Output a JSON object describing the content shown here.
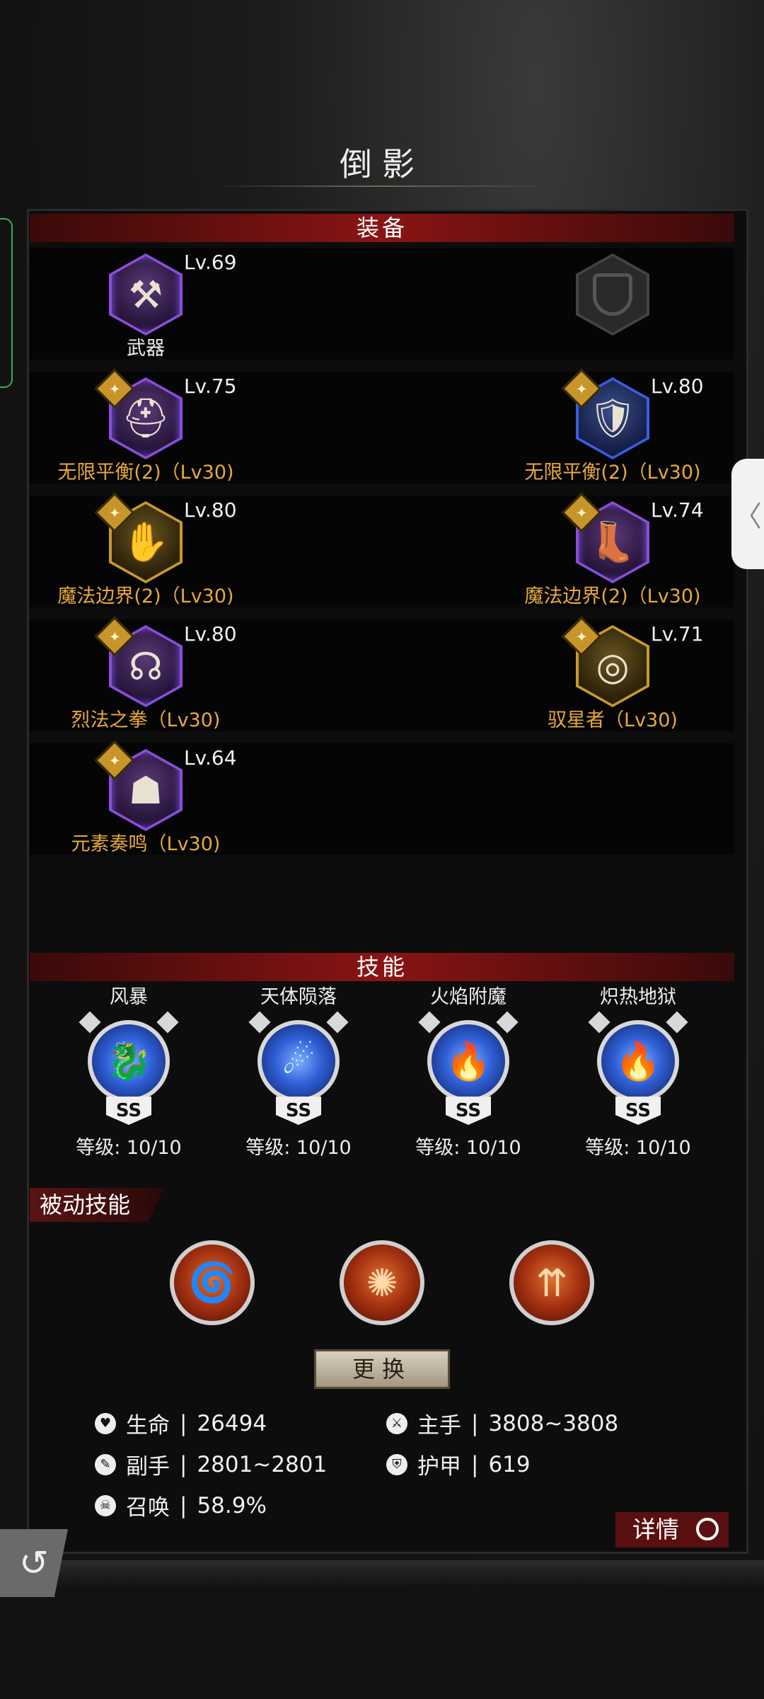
{
  "title": "倒影",
  "equipment": {
    "header": "装备",
    "rows": [
      [
        {
          "name": "武器",
          "level": "Lv.69",
          "frame": "purple",
          "glyph": "⚒",
          "badge": false,
          "name_color": "white"
        },
        {
          "name": "",
          "level": "",
          "frame": "grey",
          "glyph": "",
          "badge": false,
          "empty": true
        }
      ],
      [
        {
          "name": "无限平衡(2)（Lv30)",
          "level": "Lv.75",
          "frame": "purple",
          "glyph": "⛑",
          "badge": true
        },
        {
          "name": "无限平衡(2)（Lv30)",
          "level": "Lv.80",
          "frame": "blue",
          "glyph": "🛡",
          "badge": true
        }
      ],
      [
        {
          "name": "魔法边界(2)（Lv30)",
          "level": "Lv.80",
          "frame": "gold",
          "glyph": "✋",
          "badge": true
        },
        {
          "name": "魔法边界(2)（Lv30)",
          "level": "Lv.74",
          "frame": "purple",
          "glyph": "👢",
          "badge": true
        }
      ],
      [
        {
          "name": "烈法之拳（Lv30)",
          "level": "Lv.80",
          "frame": "purple",
          "glyph": "☊",
          "badge": true
        },
        {
          "name": "驭星者（Lv30)",
          "level": "Lv.71",
          "frame": "gold",
          "glyph": "◎",
          "badge": true
        }
      ],
      [
        {
          "name": "元素奏鸣（Lv30)",
          "level": "Lv.64",
          "frame": "purple",
          "glyph": "☗",
          "badge": true
        }
      ]
    ]
  },
  "skills": {
    "header": "技能",
    "active": [
      {
        "name": "风暴",
        "rank": "SS",
        "level": "等级: 10/10",
        "glyph": "🐉"
      },
      {
        "name": "天体陨落",
        "rank": "SS",
        "level": "等级: 10/10",
        "glyph": "☄"
      },
      {
        "name": "火焰附魔",
        "rank": "SS",
        "level": "等级: 10/10",
        "glyph": "🔥"
      },
      {
        "name": "炽热地狱",
        "rank": "SS",
        "level": "等级: 10/10",
        "glyph": "🔥"
      }
    ],
    "passive_label": "被动技能",
    "passive": [
      {
        "glyph": "🌀"
      },
      {
        "glyph": "✺"
      },
      {
        "glyph": "⇈"
      }
    ],
    "replace_label": "更换"
  },
  "stats": {
    "hp_label": "生命",
    "hp_value": "26494",
    "main_label": "主手",
    "main_value": "3808~3808",
    "off_label": "副手",
    "off_value": "2801~2801",
    "armor_label": "护甲",
    "armor_value": "619",
    "summon_label": "召唤",
    "summon_value": "58.9%"
  },
  "details_label": "详情",
  "colors": {
    "accent_red": "#8a1414",
    "gold_text": "#e8a93a"
  }
}
